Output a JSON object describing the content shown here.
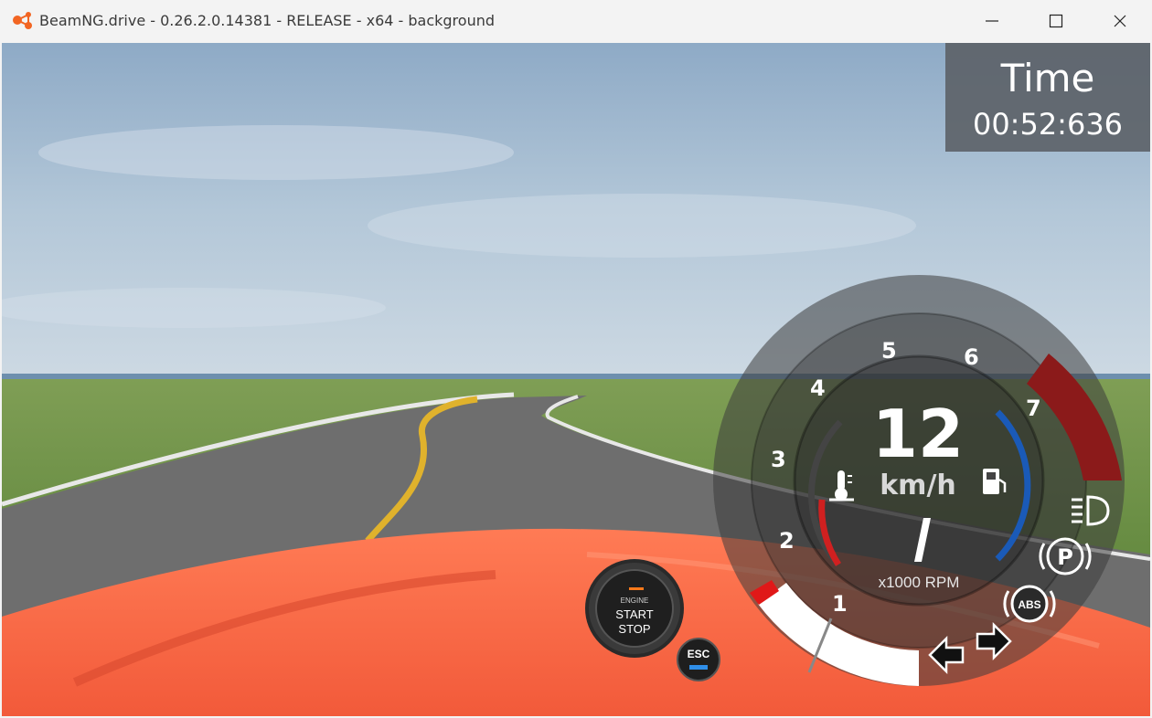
{
  "window": {
    "title": "BeamNG.drive - 0.26.2.0.14381 - RELEASE - x64 - background"
  },
  "hud": {
    "timer": {
      "label": "Time",
      "value": "00:52:636"
    },
    "speedometer": {
      "speed": "12",
      "speed_unit": "km/h",
      "gear": "/",
      "rpm_unit": "x1000 RPM",
      "rpm_ticks": [
        "1",
        "2",
        "3",
        "4",
        "5",
        "6",
        "7"
      ],
      "rpm_level_fraction": 0.1,
      "redline_color": "#8b1a1a",
      "temp_color": "#d02020",
      "fuel_color": "#1a5ab8"
    },
    "indicators": {
      "abs_label": "ABS",
      "parking_label": "P",
      "headlight_icon": "headlight-icon",
      "left_signal_icon": "arrow-left-icon",
      "right_signal_icon": "arrow-right-icon"
    },
    "engine_button": {
      "small": "ENGINE",
      "start": "START",
      "stop": "STOP"
    },
    "esc_button": {
      "label": "ESC"
    }
  }
}
